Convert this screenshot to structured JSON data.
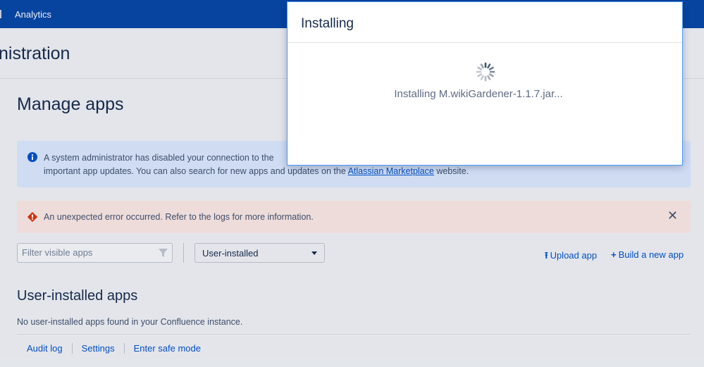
{
  "topnav": {
    "item": "Analytics"
  },
  "admin_header": {
    "title": "nistration"
  },
  "page": {
    "title": "Manage apps"
  },
  "info_message": {
    "line1": "A system administrator has disabled your connection to the",
    "line2_prefix": "important app updates. You can also search for new apps and updates on the ",
    "link": "Atlassian Marketplace",
    "line2_suffix": " website."
  },
  "error_message": {
    "text": "An unexpected error occurred. Refer to the logs for more information.",
    "close": "✕"
  },
  "filter": {
    "placeholder": "Filter visible apps"
  },
  "select": {
    "value": "User-installed"
  },
  "actions": {
    "upload_icon": "⭱",
    "upload": "Upload app",
    "build_icon": "+",
    "build": "Build a new app"
  },
  "section": {
    "title": "User-installed apps",
    "empty": "No user-installed apps found in your Confluence instance."
  },
  "footer": {
    "links": [
      "Audit log",
      "Settings",
      "Enter safe mode"
    ]
  },
  "dialog": {
    "title": "Installing",
    "message": "Installing M.wikiGardener-1.1.7.jar..."
  },
  "colors": {
    "nav": "#0747a6",
    "link": "#0052cc",
    "info_bg": "#deebff",
    "error_bg": "#ffebe6",
    "error_icon": "#de350b",
    "info_icon": "#0052cc"
  }
}
